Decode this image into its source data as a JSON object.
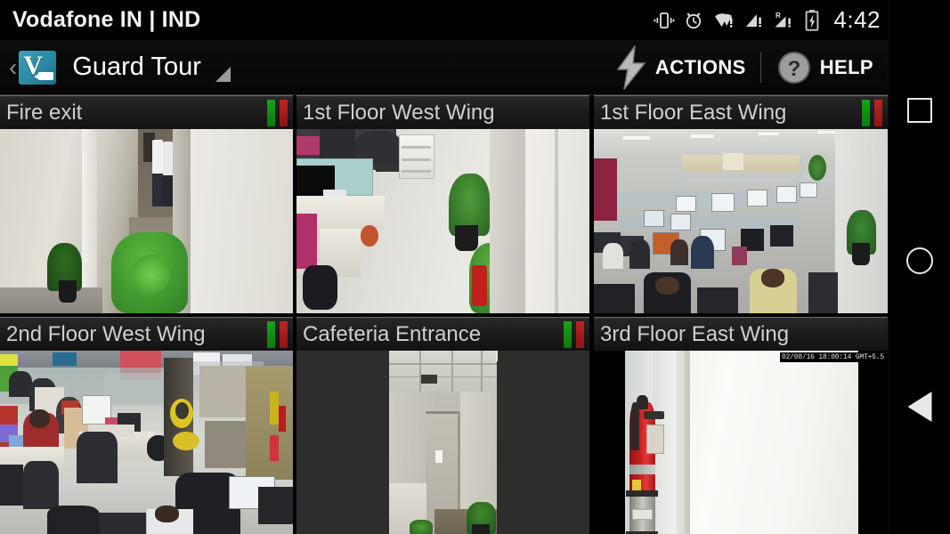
{
  "status_bar": {
    "carrier": "Vodafone IN | IND",
    "time": "4:42",
    "icons": [
      "vibrate-icon",
      "alarm-icon",
      "wifi-warning-icon",
      "signal-warning-icon",
      "roaming-signal-warning-icon",
      "battery-charging-icon"
    ]
  },
  "app_bar": {
    "back_chevron": "‹",
    "app_icon": "video-camera-app-icon",
    "app_icon_letter": "V",
    "title": "Guard Tour",
    "spinner_caret": "dropdown-caret-icon",
    "actions_label": "ACTIONS",
    "actions_icon": "lightning-bolt-icon",
    "help_label": "HELP",
    "help_icon": "question-mark-circle-icon"
  },
  "colors": {
    "status_green": "#17a316",
    "status_red": "#c12222",
    "app_accent": "#2e8ba8",
    "header_text": "#cfcfcf",
    "background": "#000000"
  },
  "cameras": [
    {
      "name": "Fire exit",
      "has_status_bars": true,
      "scene": "corridor",
      "timestamp": ""
    },
    {
      "name": "1st Floor West Wing",
      "has_status_bars": false,
      "scene": "office-aisle",
      "timestamp": ""
    },
    {
      "name": "1st Floor East Wing",
      "has_status_bars": true,
      "scene": "open-office",
      "timestamp": ""
    },
    {
      "name": "2nd Floor West Wing",
      "has_status_bars": true,
      "scene": "workstations",
      "timestamp": ""
    },
    {
      "name": "Cafeteria Entrance",
      "has_status_bars": true,
      "scene": "doorway",
      "timestamp": ""
    },
    {
      "name": "3rd Floor East Wing",
      "has_status_bars": false,
      "scene": "extinguisher",
      "timestamp": "02/08/16 18:00:14 GMT+5.5"
    }
  ],
  "nav_bar": {
    "recents": "recents-square-icon",
    "home": "home-circle-icon",
    "back": "back-triangle-icon"
  }
}
